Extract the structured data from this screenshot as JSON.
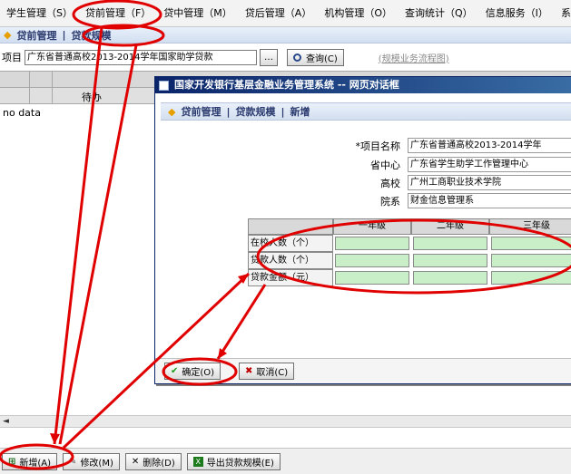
{
  "menu": {
    "items": [
      "学生管理（S）",
      "贷前管理（F）",
      "贷中管理（M）",
      "贷后管理（A）",
      "机构管理（O）",
      "查询统计（Q）",
      "信息服务（I）",
      "系"
    ]
  },
  "breadcrumb": {
    "item1": "贷前管理",
    "separator": "|",
    "item2": "贷款规模"
  },
  "search": {
    "label": "项目",
    "value": "广东省普通高校2013-2014学年国家助学贷款",
    "browse_label": "…",
    "query_label": "查询(C)",
    "flow_link": "(规模业务流程图)"
  },
  "main_table": {
    "header_pending": "待办",
    "empty_text": "no data"
  },
  "dialog": {
    "title": "国家开发银行基层金融业务管理系统 -- 网页对话框",
    "crumbs": [
      "贷前管理",
      "贷款规模",
      "新增"
    ],
    "crumb_separator": "|",
    "fields": [
      {
        "label": "*项目名称",
        "value": "广东省普通高校2013-2014学年"
      },
      {
        "label": "省中心",
        "value": "广东省学生助学工作管理中心"
      },
      {
        "label": "高校",
        "value": "广州工商职业技术学院"
      },
      {
        "label": "院系",
        "value": "财金信息管理系"
      }
    ],
    "grade_headers": [
      "一年级",
      "二年级",
      "三年级"
    ],
    "grade_rows": [
      "在校人数（个）",
      "贷款人数（个）",
      "贷款金额（元）"
    ],
    "confirm_label": "确定(O)",
    "cancel_label": "取消(C)"
  },
  "toolbar": {
    "add_label": "新增(A)",
    "edit_label": "修改(M)",
    "delete_label": "删除(D)",
    "export_label": "导出贷款规模(E)"
  },
  "colors": {
    "annotation": "#e00000",
    "dialog_title": "#0a246a",
    "input_green": "#c8efc8"
  }
}
